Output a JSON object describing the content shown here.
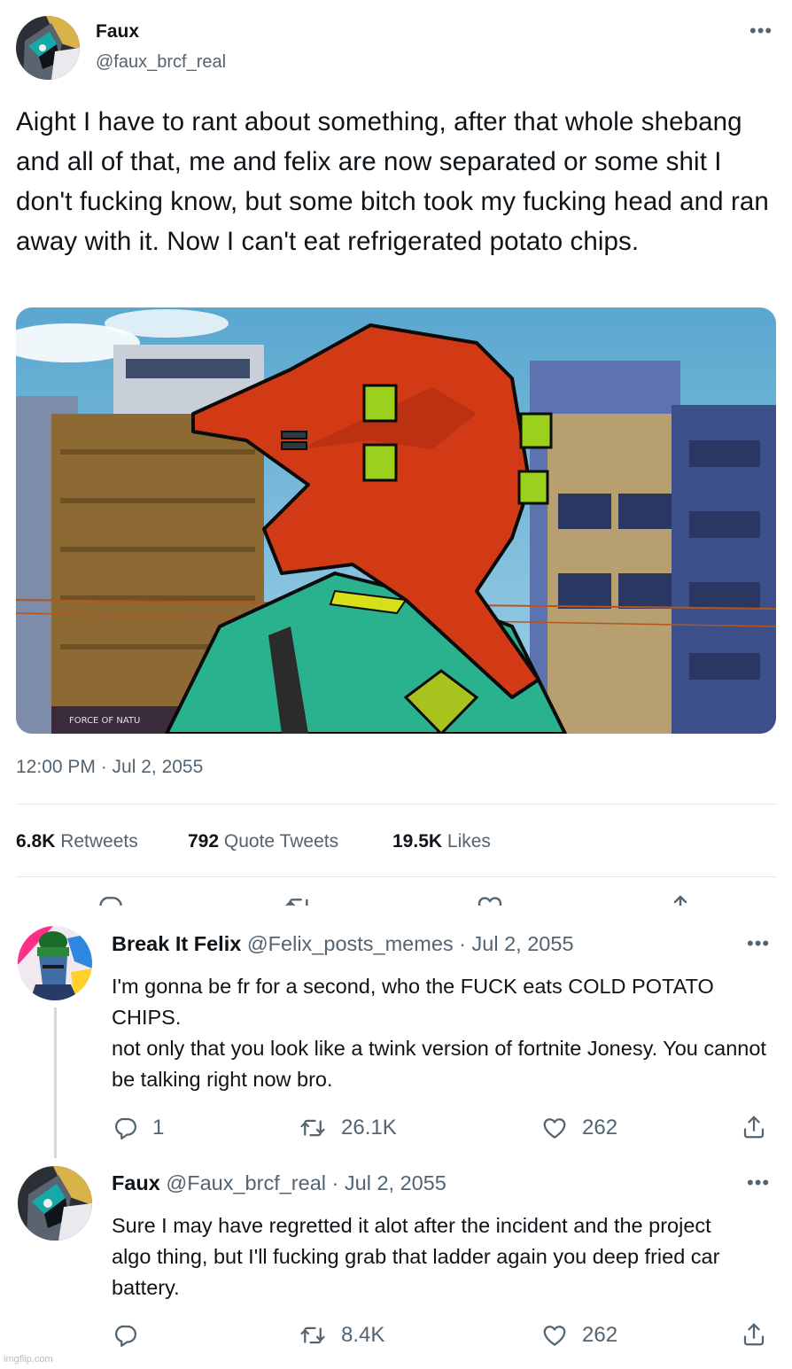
{
  "main_tweet": {
    "author_name": "Faux",
    "handle": "@faux_brcf_real",
    "text": "Aight I have to rant about something, after that whole shebang and all of that, me and felix are now separated or some shit I don't fucking know, but some bitch took my fucking head and ran away with it. Now I can't eat refrigerated potato chips.",
    "image_sign_text": "FORCE OF NATU",
    "timestamp": "12:00 PM · Jul 2, 2055",
    "stats": {
      "retweets_count": "6.8K",
      "retweets_label": "Retweets",
      "quotes_count": "792",
      "quotes_label": "Quote Tweets",
      "likes_count": "19.5K",
      "likes_label": "Likes"
    }
  },
  "replies": [
    {
      "author_name": "Break It Felix",
      "handle_date": "@Felix_posts_memes · Jul 2, 2055",
      "text_line1": "I'm gonna be fr for a second, who the FUCK eats COLD POTATO CHIPS.",
      "text_line2": "not only that you look like a twink version of fortnite Jonesy. You cannot be talking right now bro.",
      "reply_count": "1",
      "retweet_count": "26.1K",
      "like_count": "262"
    },
    {
      "author_name": "Faux",
      "handle_date": "@Faux_brcf_real · Jul 2, 2055",
      "text": "Sure I may have regretted it alot after the incident and the project algo thing, but I'll fucking grab that ladder again you deep fried car battery.",
      "retweet_count": "8.4K",
      "like_count": "262"
    }
  ],
  "watermark": "imgflip.com",
  "colors": {
    "text": "#0f1419",
    "muted": "#536471",
    "divider": "#e4e8eb",
    "thread_line": "#cfd9de",
    "character_head": "#d23a16",
    "character_eyes": "#9bd11d",
    "character_body": "#2ab28f"
  },
  "icons": [
    "more-icon",
    "reply-icon",
    "retweet-icon",
    "like-icon",
    "share-icon"
  ]
}
